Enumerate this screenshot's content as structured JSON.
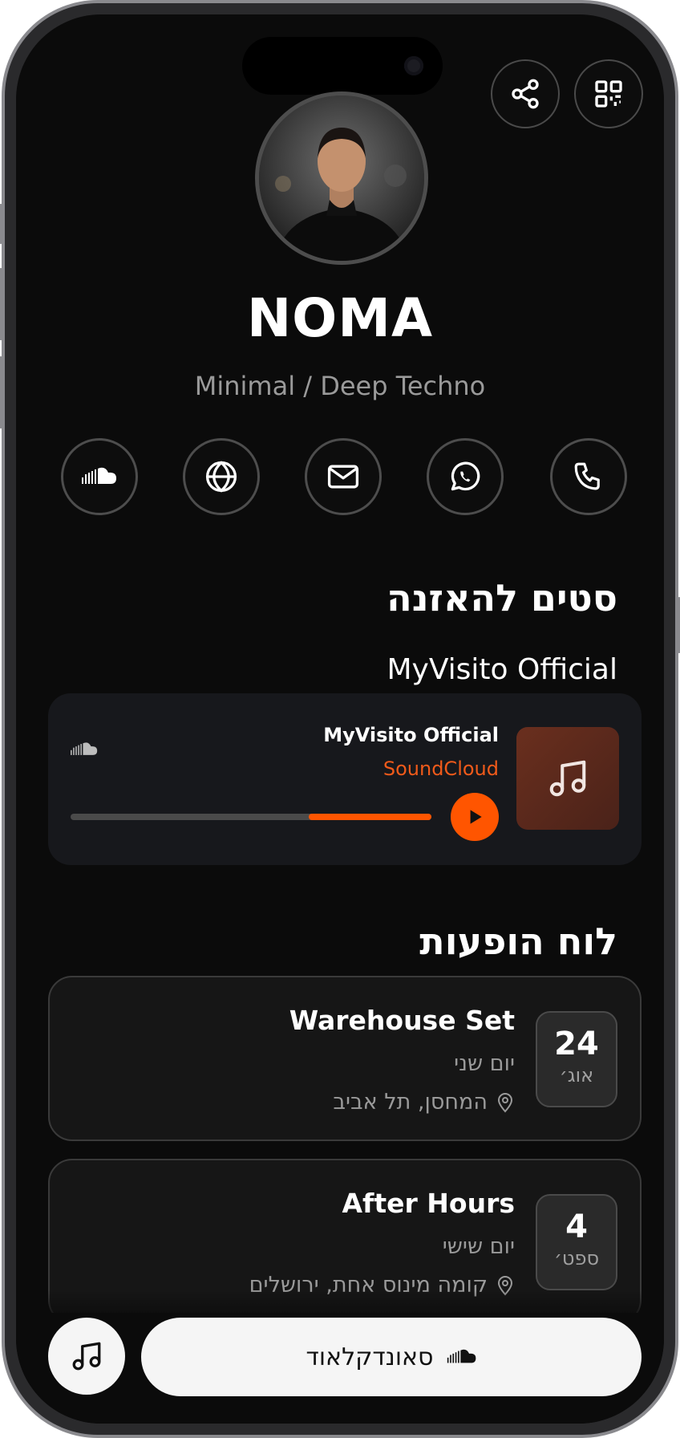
{
  "profile": {
    "name": "NOMA",
    "genre": "Minimal / Deep Techno"
  },
  "header": {
    "share_icon": "share-icon",
    "qr_icon": "qr-code-icon"
  },
  "social_links": [
    {
      "icon": "soundcloud-icon"
    },
    {
      "icon": "globe-icon"
    },
    {
      "icon": "mail-icon"
    },
    {
      "icon": "whatsapp-icon"
    },
    {
      "icon": "phone-icon"
    }
  ],
  "sets": {
    "heading": "סטים להאזנה",
    "subheading": "MyVisito Official",
    "player": {
      "title": "MyVisito Official",
      "source": "SoundCloud",
      "progress": 0.34,
      "accent": "#ff5500"
    }
  },
  "events": {
    "heading": "לוח הופעות",
    "items": [
      {
        "day": "24",
        "month": "אוג׳",
        "title": "Warehouse Set",
        "weekday": "יום שני",
        "location": "המחסן, תל אביב"
      },
      {
        "day": "4",
        "month": "ספט׳",
        "title": "After Hours",
        "weekday": "יום שישי",
        "location": "קומה מינוס אחת, ירושלים"
      }
    ]
  },
  "bottom": {
    "soundcloud_label": "סאונדקלאוד"
  }
}
